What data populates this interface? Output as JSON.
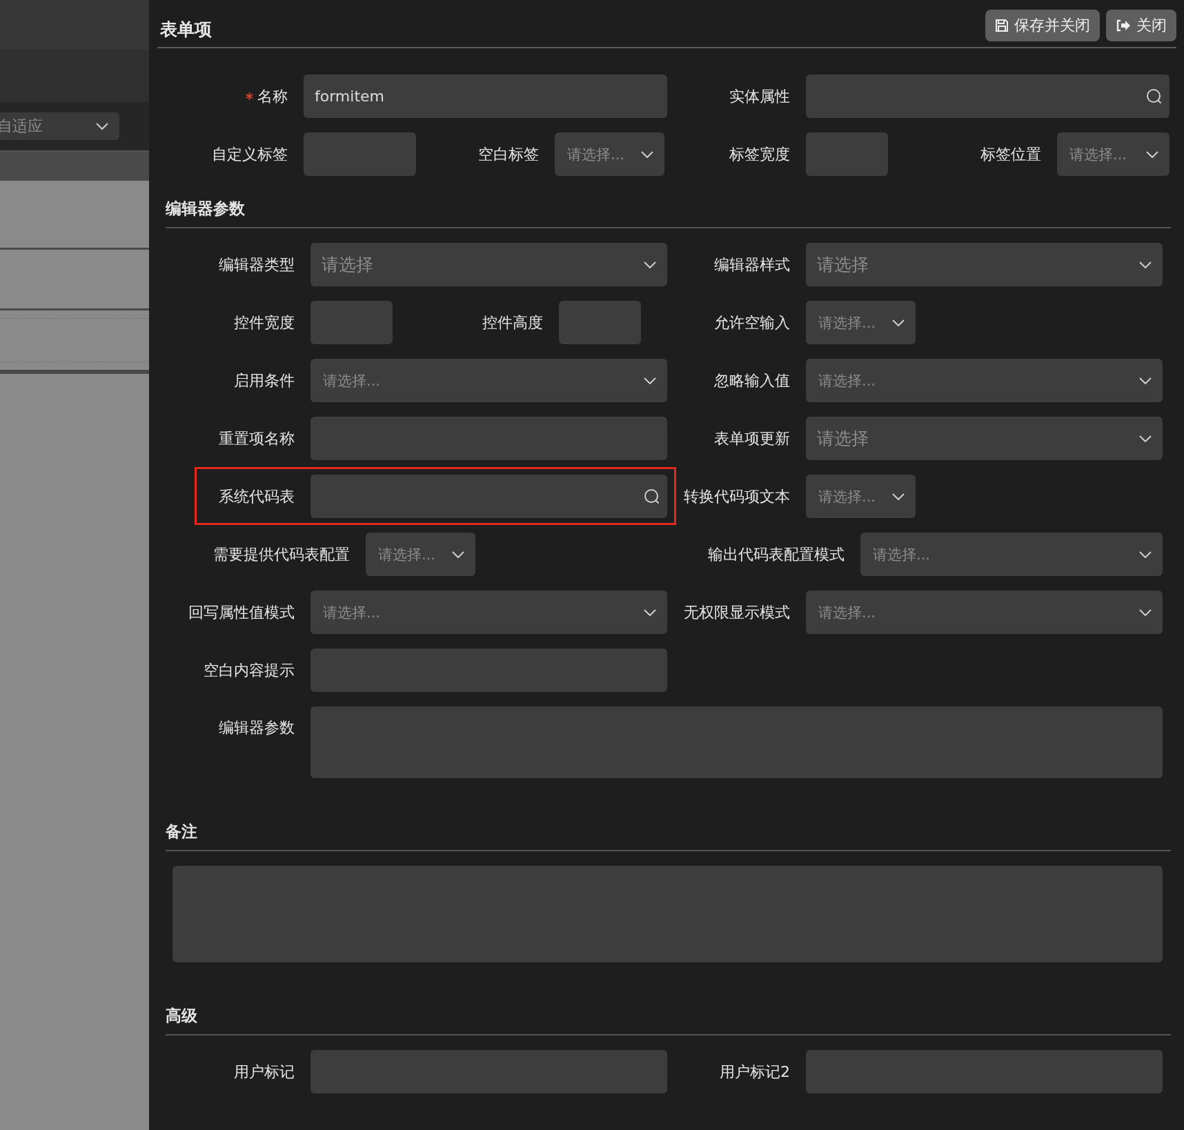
{
  "backdrop": {
    "dropdown": {
      "value": "自适应"
    }
  },
  "header": {
    "title": "表单项",
    "buttons": [
      {
        "label": "保存并关闭"
      },
      {
        "label": "关闭"
      }
    ]
  },
  "basic": {
    "rows": [
      {
        "fields": [
          {
            "label": "名称",
            "kind": "text",
            "value": "formitem",
            "required": true,
            "highlighted": false
          },
          {
            "label": "实体属性",
            "kind": "search",
            "required": false,
            "highlighted": false
          }
        ]
      },
      {
        "fields": [
          {
            "label": "自定义标签",
            "kind": "text",
            "required": false,
            "highlighted": false
          },
          {
            "label": "空白标签",
            "kind": "select",
            "placeholder": "请选择...",
            "required": false,
            "highlighted": false
          },
          {
            "label": "标签宽度",
            "kind": "text",
            "required": false,
            "highlighted": false
          },
          {
            "label": "标签位置",
            "kind": "select",
            "placeholder": "请选择...",
            "required": false,
            "highlighted": false
          }
        ]
      }
    ]
  },
  "sections": [
    {
      "title": "编辑器参数",
      "rows": [
        {
          "fields": [
            {
              "label": "编辑器类型",
              "kind": "select",
              "placeholder": "请选择",
              "required": false,
              "highlighted": false
            },
            {
              "label": "编辑器样式",
              "kind": "select",
              "placeholder": "请选择",
              "required": false,
              "highlighted": false
            }
          ]
        },
        {
          "fields": [
            {
              "label": "控件宽度",
              "kind": "text",
              "required": false,
              "highlighted": false
            },
            {
              "label": "控件高度",
              "kind": "text",
              "required": false,
              "highlighted": false
            },
            {
              "label": "允许空输入",
              "kind": "select",
              "placeholder": "请选择...",
              "required": false,
              "highlighted": false
            }
          ]
        },
        {
          "fields": [
            {
              "label": "启用条件",
              "kind": "select",
              "placeholder": "请选择...",
              "required": false,
              "highlighted": false
            },
            {
              "label": "忽略输入值",
              "kind": "select",
              "placeholder": "请选择...",
              "required": false,
              "highlighted": false
            }
          ]
        },
        {
          "fields": [
            {
              "label": "重置项名称",
              "kind": "text",
              "required": false,
              "highlighted": false
            },
            {
              "label": "表单项更新",
              "kind": "select",
              "placeholder": "请选择",
              "required": false,
              "highlighted": false
            }
          ]
        },
        {
          "fields": [
            {
              "label": "系统代码表",
              "kind": "search",
              "required": false,
              "highlighted": true
            },
            {
              "label": "转换代码项文本",
              "kind": "select",
              "placeholder": "请选择...",
              "required": false,
              "highlighted": false
            }
          ]
        },
        {
          "fields": [
            {
              "label": "需要提供代码表配置",
              "kind": "select",
              "placeholder": "请选择...",
              "required": false,
              "highlighted": false
            },
            {
              "label": "输出代码表配置模式",
              "kind": "select",
              "placeholder": "请选择...",
              "required": false,
              "highlighted": false
            }
          ]
        },
        {
          "fields": [
            {
              "label": "回写属性值模式",
              "kind": "select",
              "placeholder": "请选择...",
              "required": false,
              "highlighted": false
            },
            {
              "label": "无权限显示模式",
              "kind": "select",
              "placeholder": "请选择...",
              "required": false,
              "highlighted": false
            }
          ]
        },
        {
          "fields": [
            {
              "label": "空白内容提示",
              "kind": "text",
              "required": false,
              "highlighted": false
            }
          ]
        },
        {
          "fields": [
            {
              "label": "编辑器参数",
              "kind": "textarea",
              "required": false,
              "highlighted": false
            }
          ]
        }
      ]
    },
    {
      "title": "备注",
      "rows": [
        {
          "fields": [
            {
              "kind": "textarea",
              "required": false,
              "highlighted": false
            }
          ]
        }
      ]
    },
    {
      "title": "高级",
      "rows": [
        {
          "fields": [
            {
              "label": "用户标记",
              "kind": "text",
              "required": false,
              "highlighted": false
            },
            {
              "label": "用户标记2",
              "kind": "text",
              "required": false,
              "highlighted": false
            }
          ]
        }
      ]
    }
  ]
}
